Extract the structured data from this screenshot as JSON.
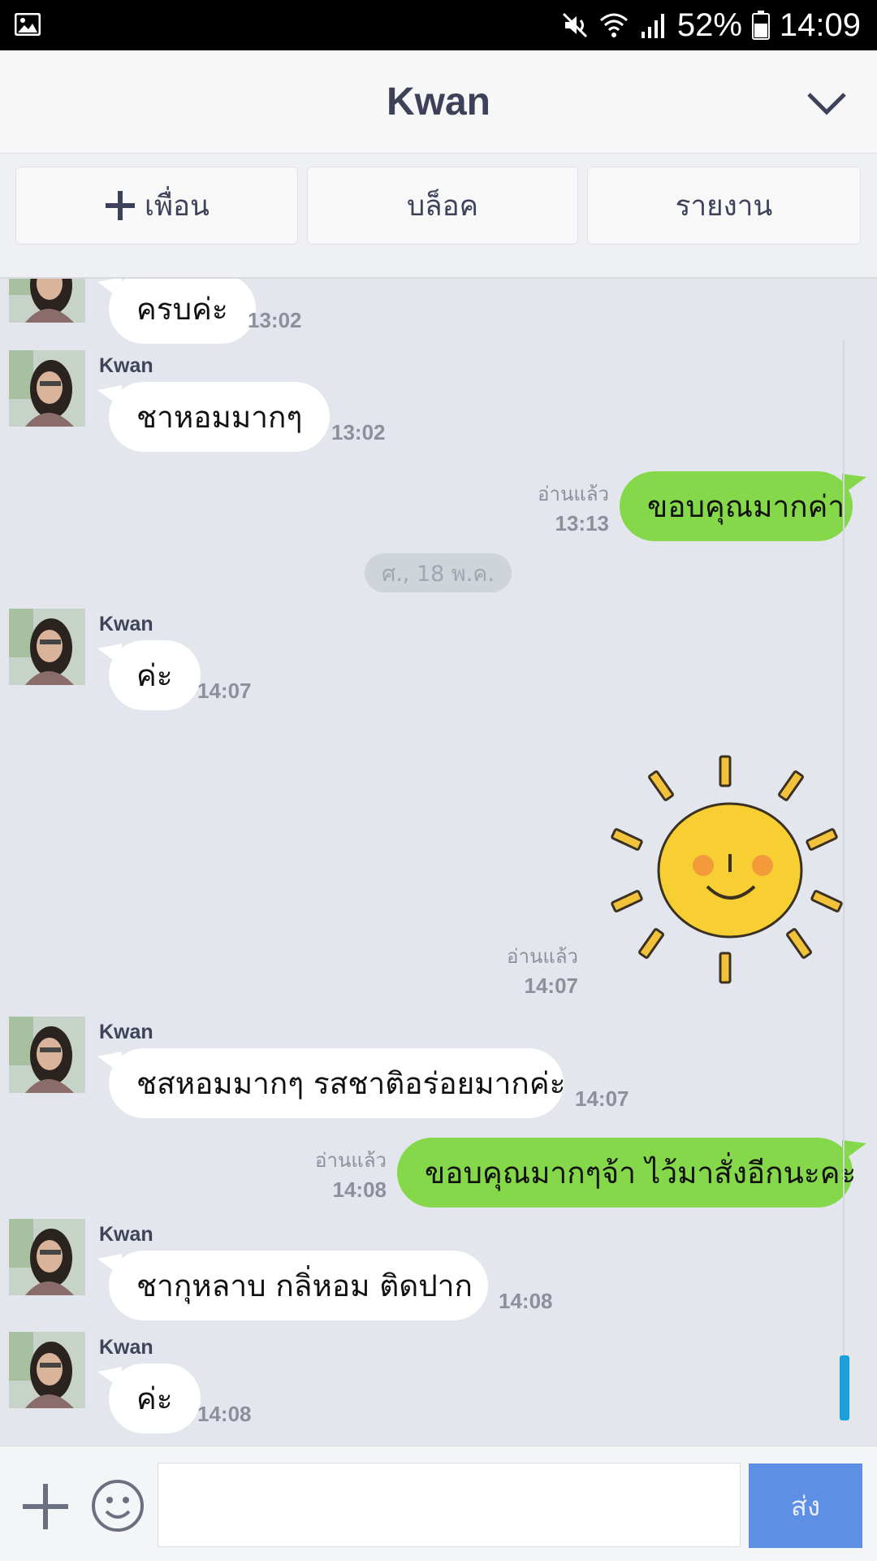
{
  "status_bar": {
    "battery": "52%",
    "time": "14:09",
    "icons": [
      "gallery-icon",
      "mute-icon",
      "wifi-icon",
      "signal-icon",
      "battery-icon"
    ]
  },
  "header": {
    "title": "Kwan",
    "chevron_icon": "chevron-down-icon"
  },
  "actions": {
    "add_friend": "เพื่อน",
    "block": "บล็อค",
    "report": "รายงาน"
  },
  "chat": {
    "date_separator": "ศ., 18 พ.ค.",
    "messages": [
      {
        "sender": "",
        "text": "ครบค่ะ",
        "time": "13:02"
      },
      {
        "sender": "Kwan",
        "text": "ชาหอมมากๆ",
        "time": "13:02"
      },
      {
        "status": "อ่านแล้ว",
        "text": "ขอบคุณมากค่า",
        "time": "13:13"
      },
      {
        "sender": "Kwan",
        "text": "ค่ะ",
        "time": "14:07"
      },
      {
        "status": "อ่านแล้ว",
        "sticker": "sun-sticker-icon",
        "time": "14:07"
      },
      {
        "sender": "Kwan",
        "text": "ชสหอมมากๆ รสชาติอร่อยมากค่ะ",
        "time": "14:07"
      },
      {
        "status": "อ่านแล้ว",
        "text": "ขอบคุณมากๆจ้า ไว้มาสั่งอีกนะคะ",
        "time": "14:08"
      },
      {
        "sender": "Kwan",
        "text": "ชากุหลาบ กลิ่หอม ติดปาก",
        "time": "14:08"
      },
      {
        "sender": "Kwan",
        "text": "ค่ะ",
        "time": "14:08"
      }
    ]
  },
  "input_bar": {
    "send_label": "ส่ง",
    "placeholder": ""
  },
  "colors": {
    "outgoing": "#84d84a",
    "incoming": "#ffffff",
    "send_button": "#5f8fe4",
    "scroll_thumb": "#1d9fd8"
  }
}
